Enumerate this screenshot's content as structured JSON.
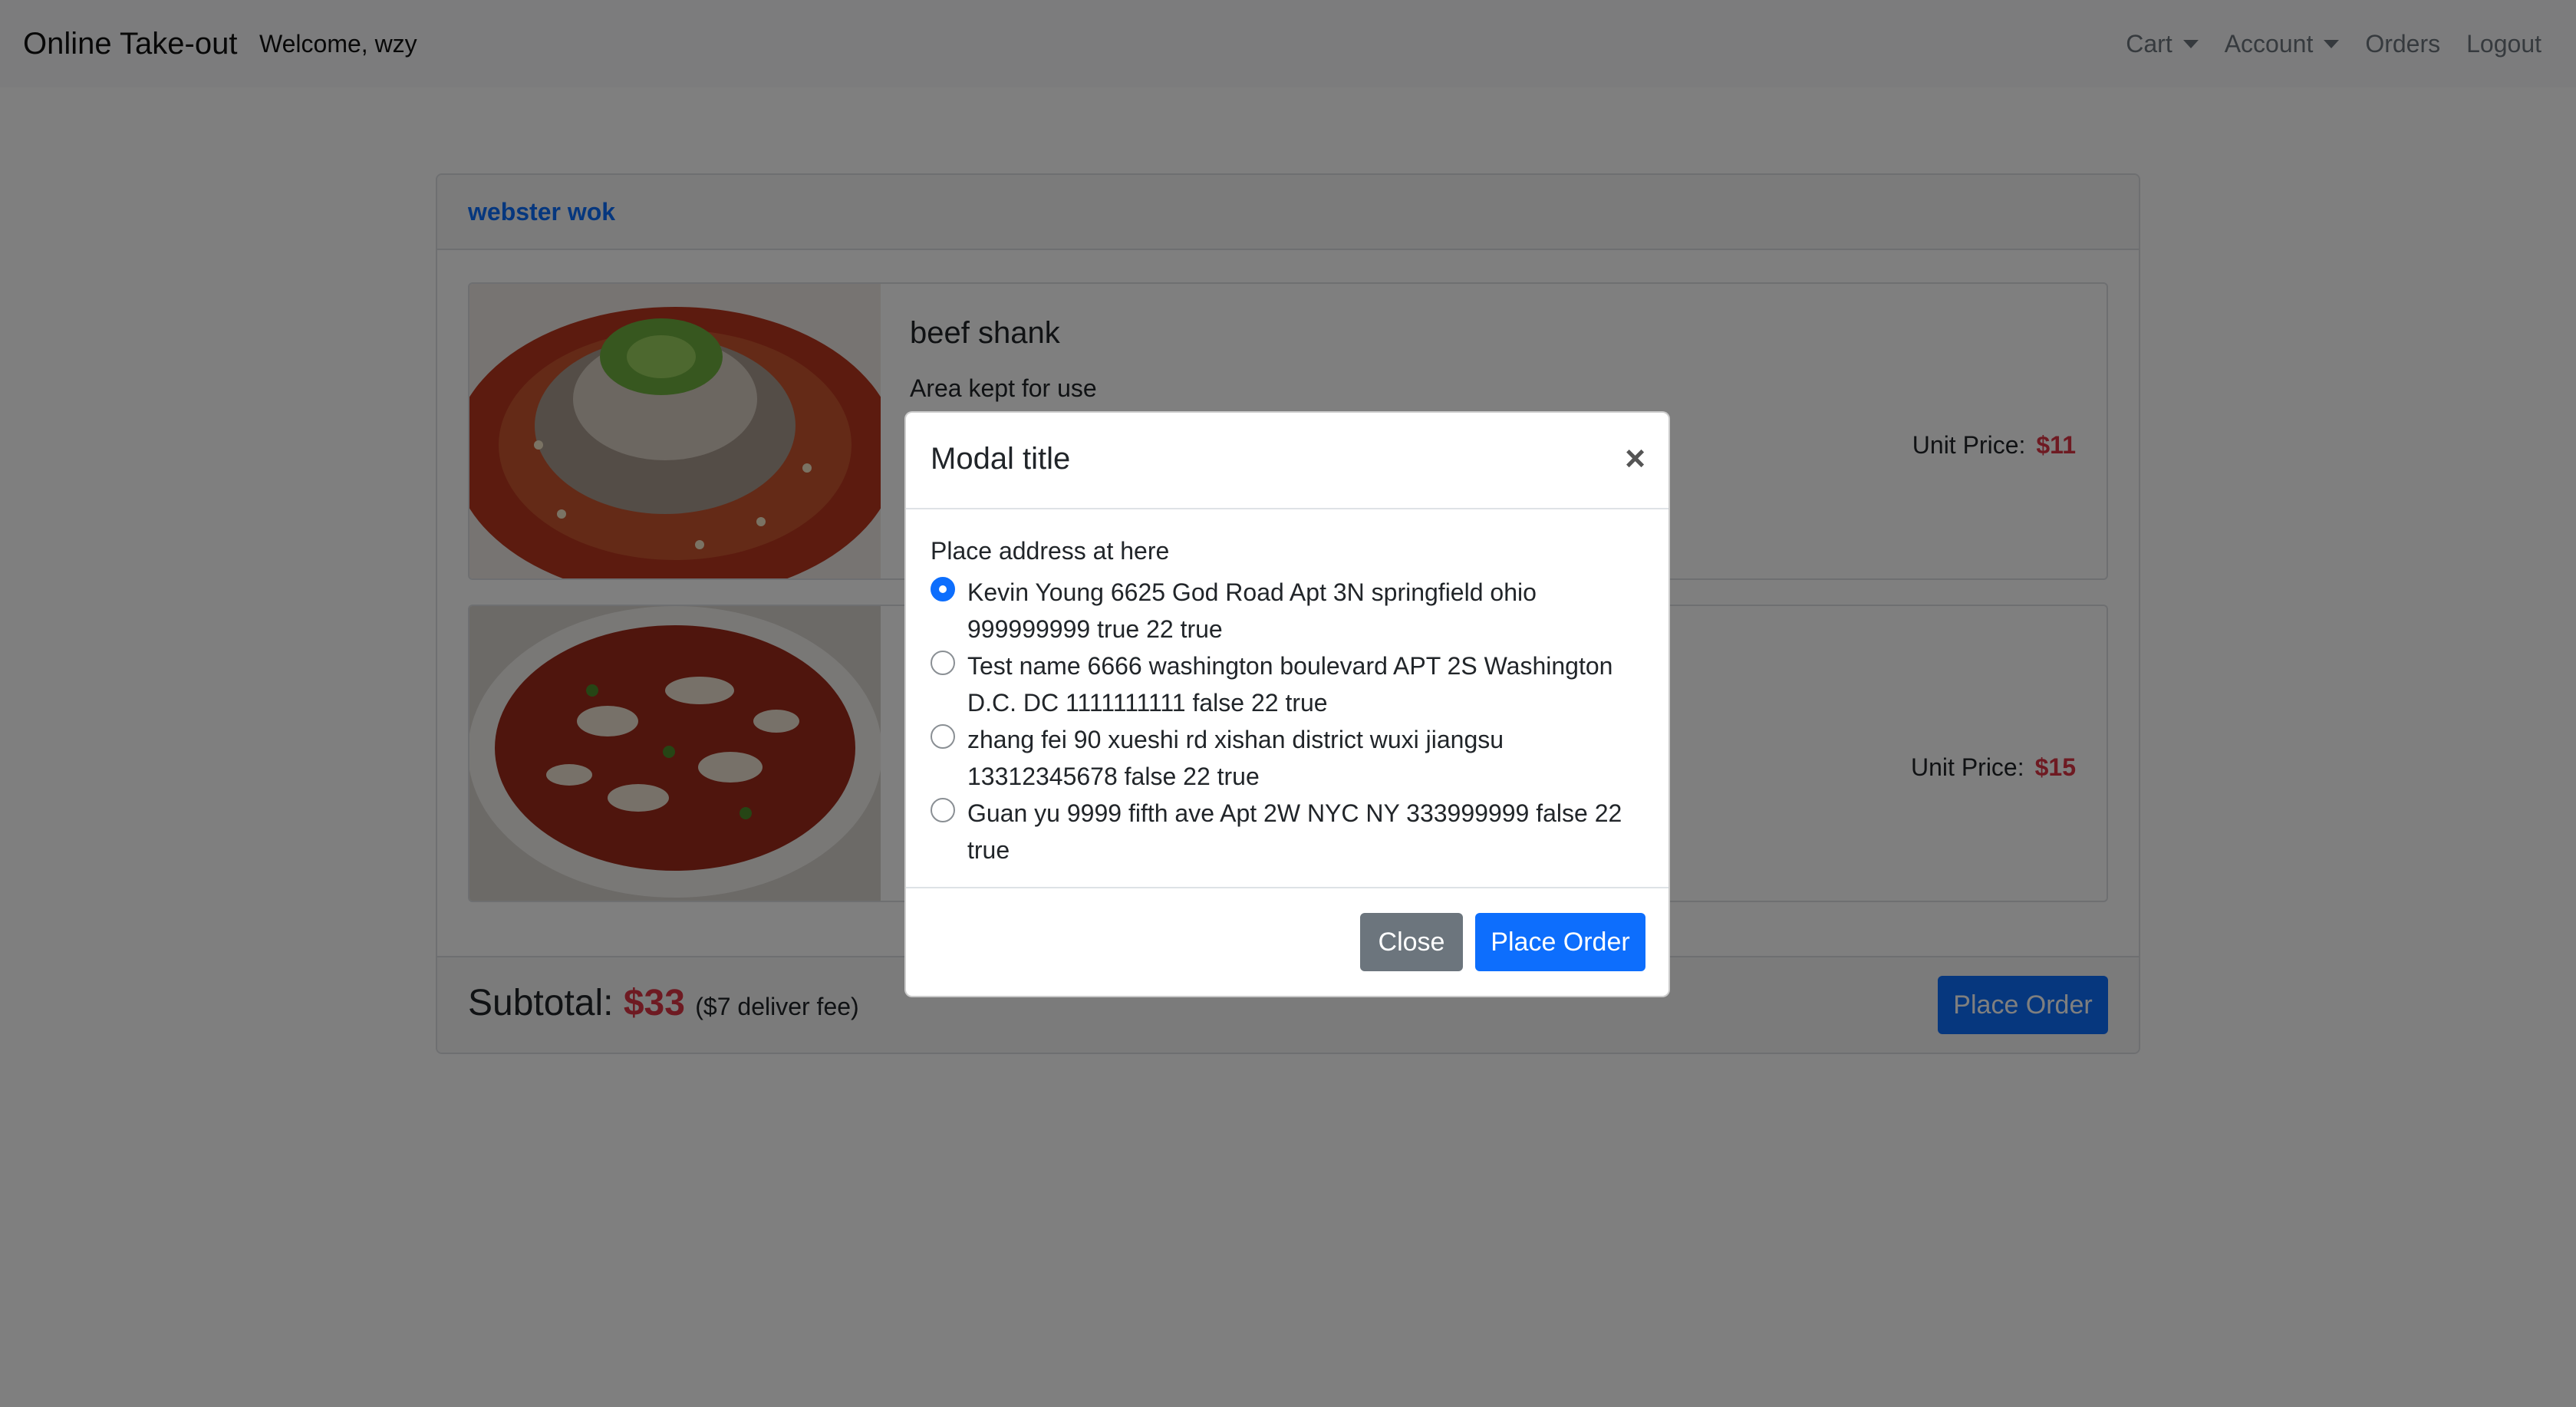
{
  "navbar": {
    "brand": "Online Take-out",
    "welcome": "Welcome, wzy",
    "links": {
      "cart": "Cart",
      "account": "Account",
      "orders": "Orders",
      "logout": "Logout"
    }
  },
  "store": {
    "name": "webster wok"
  },
  "items": [
    {
      "name": "beef shank",
      "description": "Area kept for use",
      "unit_price_label": "Unit Price:",
      "unit_price": "$11"
    },
    {
      "name": "",
      "description": "",
      "unit_price_label": "Unit Price:",
      "unit_price": "$15"
    }
  ],
  "footer": {
    "subtotal_label": "Subtotal:",
    "subtotal_value": "$33",
    "fee_note": "($7 deliver fee)",
    "place_order": "Place Order"
  },
  "modal": {
    "title": "Modal title",
    "close_symbol": "×",
    "body_label": "Place address at here",
    "addresses": [
      {
        "text": "Kevin Young 6625 God Road Apt 3N springfield ohio 999999999 true 22 true",
        "selected": true
      },
      {
        "text": "Test name 6666 washington boulevard APT 2S Washington D.C. DC 1111111111 false 22 true",
        "selected": false
      },
      {
        "text": "zhang fei 90 xueshi rd xishan district wuxi jiangsu 13312345678 false 22 true",
        "selected": false
      },
      {
        "text": "Guan yu 9999 fifth ave Apt 2W NYC NY 333999999 false 22 true",
        "selected": false
      }
    ],
    "close_button": "Close",
    "place_order_button": "Place Order"
  },
  "colors": {
    "primary": "#0d6efd",
    "secondary": "#6c757d",
    "price": "#dc3545",
    "backdrop": "rgba(0,0,0,0.5)"
  }
}
